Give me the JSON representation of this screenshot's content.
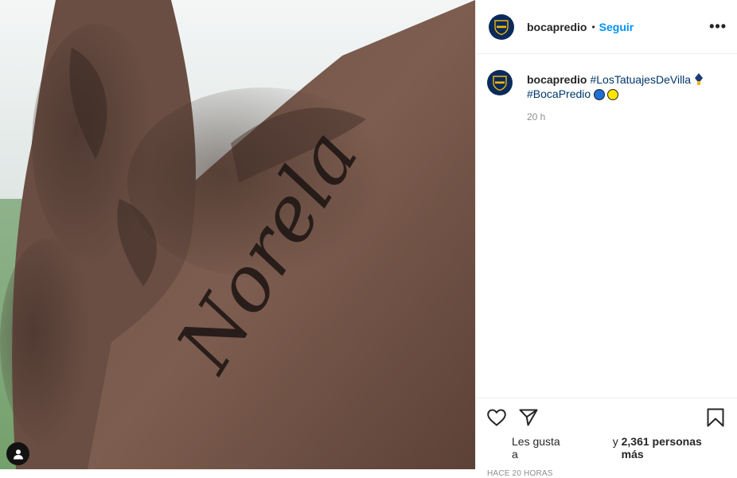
{
  "header": {
    "username": "bocapredio",
    "separator": "•",
    "follow_label": "Seguir",
    "more_label": "•••"
  },
  "photo": {
    "tattoo_text": "Norela",
    "tag_icon": "user-tag-icon"
  },
  "caption": {
    "username": "bocapredio",
    "hashtag_1": "#LosTatuajesDeVilla",
    "hashtag_2": "#BocaPredio",
    "emoji_colors": [
      "#1e6fd6",
      "#ffe500"
    ],
    "time": "20 h"
  },
  "actions": {
    "like_icon": "heart-icon",
    "share_icon": "paper-plane-icon",
    "save_icon": "bookmark-icon"
  },
  "likes": {
    "prefix": "Les gusta a",
    "suffix_pre": "y",
    "count_text": "2,361 personas más"
  },
  "timestamp": "HACE 20 HORAS",
  "colors": {
    "accent": "#0095f6",
    "hashtag": "#00376b",
    "brand_navy": "#0b2a5c",
    "brand_gold": "#f2b705"
  }
}
